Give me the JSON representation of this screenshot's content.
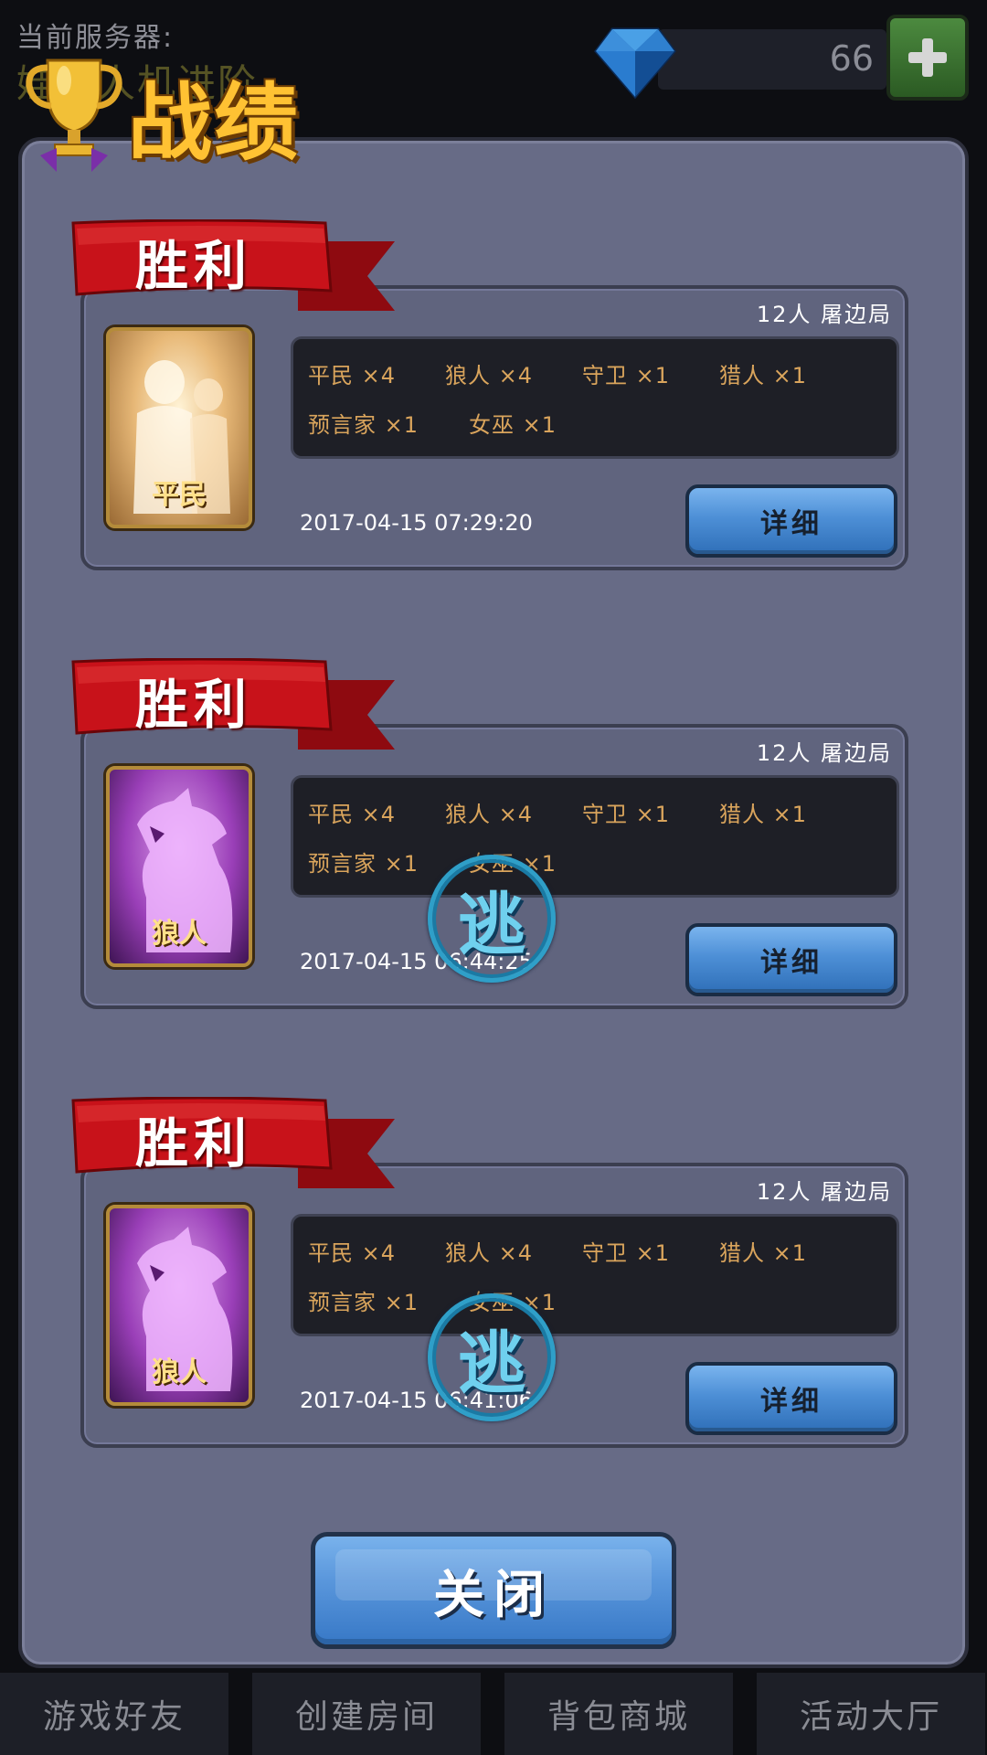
{
  "header": {
    "server_label": "当前服务器:",
    "server_name": "娃娃人机进阶",
    "gem_count": "66",
    "plus_label": "+"
  },
  "title": "战绩",
  "records": [
    {
      "result": "胜利",
      "mode": "12人  屠边局",
      "role": "平民",
      "role_type": "civilian",
      "roles_line1": [
        "平民 ×4",
        "狼人 ×4",
        "守卫 ×1",
        "猎人 ×1"
      ],
      "roles_line2": [
        "预言家 ×1",
        "女巫 ×1"
      ],
      "timestamp": "2017-04-15 07:29:20",
      "detail_label": "详细",
      "escaped": false
    },
    {
      "result": "胜利",
      "mode": "12人  屠边局",
      "role": "狼人",
      "role_type": "wolf",
      "roles_line1": [
        "平民 ×4",
        "狼人 ×4",
        "守卫 ×1",
        "猎人 ×1"
      ],
      "roles_line2": [
        "预言家 ×1",
        "女巫 ×1"
      ],
      "timestamp": "2017-04-15 06:44:25",
      "detail_label": "详细",
      "escaped": true,
      "escape_label": "逃"
    },
    {
      "result": "胜利",
      "mode": "12人  屠边局",
      "role": "狼人",
      "role_type": "wolf",
      "roles_line1": [
        "平民 ×4",
        "狼人 ×4",
        "守卫 ×1",
        "猎人 ×1"
      ],
      "roles_line2": [
        "预言家 ×1",
        "女巫 ×1"
      ],
      "timestamp": "2017-04-15 06:41:06",
      "detail_label": "详细",
      "escaped": true,
      "escape_label": "逃"
    }
  ],
  "close_label": "关闭",
  "bottom_nav": [
    "游戏好友",
    "创建房间",
    "背包商城",
    "活动大厅"
  ],
  "colors": {
    "panel": "#676b86",
    "banner_red": "#c8121a",
    "button_blue": "#4d8fd6",
    "title_gold": "#ffc233",
    "role_text": "#d9a45c"
  },
  "icons": [
    "gem-icon",
    "plus-icon",
    "trophy-icon",
    "ribbon-banner",
    "civilian-silhouette",
    "wolf-silhouette",
    "escape-seal"
  ]
}
